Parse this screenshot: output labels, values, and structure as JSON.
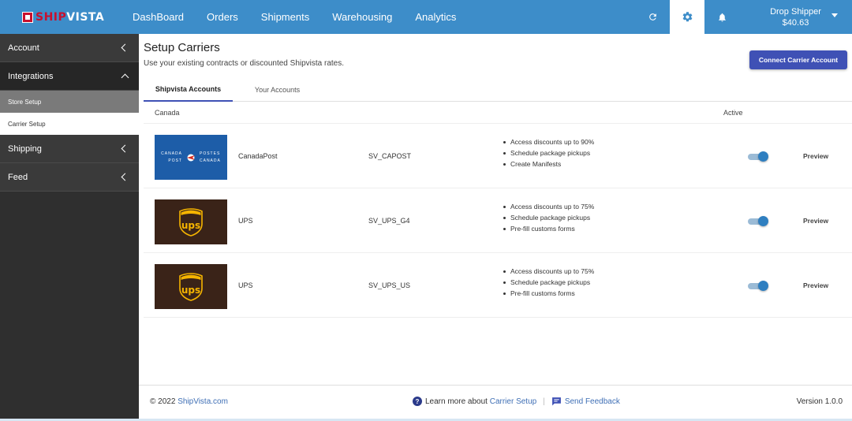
{
  "brand": {
    "ship": "SHIP",
    "vista": "VISTA"
  },
  "nav": [
    {
      "label": "DashBoard"
    },
    {
      "label": "Orders"
    },
    {
      "label": "Shipments"
    },
    {
      "label": "Warehousing"
    },
    {
      "label": "Analytics"
    }
  ],
  "user": {
    "name": "Drop Shipper",
    "balance": "$40.63"
  },
  "sidebar": {
    "account": "Account",
    "integrations": "Integrations",
    "store_setup": "Store Setup",
    "carrier_setup": "Carrier Setup",
    "shipping": "Shipping",
    "feed": "Feed"
  },
  "page": {
    "title": "Setup Carriers",
    "subtitle": "Use your existing contracts or discounted Shipvista rates.",
    "connect_button": "Connect Carrier Account"
  },
  "tabs": [
    {
      "label": "Shipvista Accounts",
      "active": true
    },
    {
      "label": "Your Accounts",
      "active": false
    }
  ],
  "table": {
    "region": "Canada",
    "active_header": "Active",
    "rows": [
      {
        "logo": "canada-post",
        "name": "CanadaPost",
        "code": "SV_CAPOST",
        "features": [
          "Access discounts up to 90%",
          "Schedule package pickups",
          "Create Manifests"
        ],
        "active": true,
        "preview": "Preview"
      },
      {
        "logo": "ups",
        "name": "UPS",
        "code": "SV_UPS_G4",
        "features": [
          "Access discounts up to 75%",
          "Schedule package pickups",
          "Pre-fill customs forms"
        ],
        "active": true,
        "preview": "Preview"
      },
      {
        "logo": "ups",
        "name": "UPS",
        "code": "SV_UPS_US",
        "features": [
          "Access discounts up to 75%",
          "Schedule package pickups",
          "Pre-fill customs forms"
        ],
        "active": true,
        "preview": "Preview"
      }
    ]
  },
  "canada_post_logo": {
    "l1": "CANADA",
    "l2": "POST",
    "r1": "POSTES",
    "r2": "CANADA"
  },
  "ups_logo_text": "ups",
  "footer": {
    "copyright": "© 2022",
    "site": "ShipVista.com",
    "learn_more": "Learn more about",
    "learn_link": "Carrier Setup",
    "feedback": "Send Feedback",
    "version": "Version 1.0.0"
  },
  "colors": {
    "topbar": "#3d8dc9",
    "accent": "#3f51b5",
    "sidebar": "#2f2f2f"
  }
}
